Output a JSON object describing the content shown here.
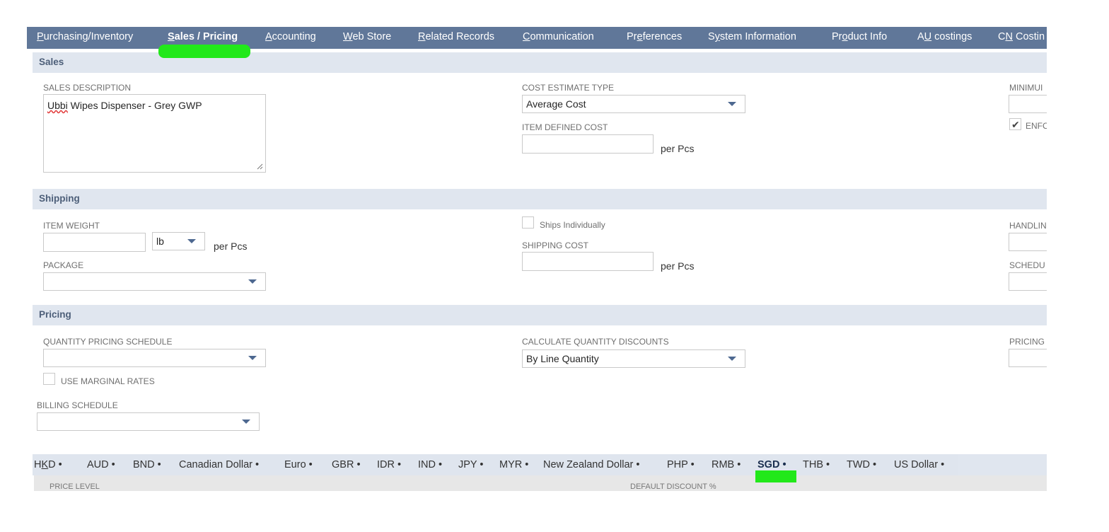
{
  "tabs": [
    {
      "pre": "",
      "ul": "P",
      "post": "urchasing/Inventory"
    },
    {
      "pre": "",
      "ul": "S",
      "post": "ales / Pricing"
    },
    {
      "pre": "",
      "ul": "A",
      "post": "ccounting"
    },
    {
      "pre": "",
      "ul": "W",
      "post": "eb Store"
    },
    {
      "pre": "",
      "ul": "R",
      "post": "elated Records"
    },
    {
      "pre": "",
      "ul": "C",
      "post": "ommunication"
    },
    {
      "pre": "Pr",
      "ul": "e",
      "post": "ferences"
    },
    {
      "pre": "S",
      "ul": "y",
      "post": "stem Information"
    },
    {
      "pre": "Pr",
      "ul": "o",
      "post": "duct Info"
    },
    {
      "pre": "A",
      "ul": "U",
      "post": " costings"
    },
    {
      "pre": "C",
      "ul": "N",
      "post": " Costin"
    }
  ],
  "sections": {
    "sales": "Sales",
    "shipping": "Shipping",
    "pricing": "Pricing"
  },
  "sales": {
    "sales_description_label": "Sales Description",
    "sales_description_word1": "Ubbi",
    "sales_description_rest": " Wipes Dispenser - Grey GWP",
    "cost_estimate_type_label": "Cost Estimate Type",
    "cost_estimate_type_value": "Average Cost",
    "item_defined_cost_label": "Item Defined Cost",
    "per_unit": "per Pcs",
    "minimum_label": "MINIMUI",
    "enforce_label": "ENFC"
  },
  "shipping": {
    "item_weight_label": "Item Weight",
    "weight_unit": "lb",
    "per_unit": "per Pcs",
    "package_label": "Package",
    "ships_individually_label": "Ships Individually",
    "shipping_cost_label": "Shipping Cost",
    "shipping_per_unit": "per Pcs",
    "handling_label": "HANDLIN",
    "schedule_label": "SCHEDU"
  },
  "pricing": {
    "quantity_pricing_schedule_label": "Quantity Pricing Schedule",
    "use_marginal_rates_label": "Use Marginal Rates",
    "billing_schedule_label": "Billing Schedule",
    "calculate_quantity_discounts_label": "Calculate Quantity Discounts",
    "calculate_quantity_discounts_value": "By Line Quantity",
    "pricing_label": "PRICING"
  },
  "currencies": [
    {
      "pre": "H",
      "ul": "K",
      "post": "D",
      "dot": " •"
    },
    {
      "pre": "",
      "ul": "",
      "post": "AUD",
      "dot": " •"
    },
    {
      "pre": "",
      "ul": "",
      "post": "BND",
      "dot": " •"
    },
    {
      "pre": "",
      "ul": "",
      "post": "Canadian Dollar",
      "dot": " •"
    },
    {
      "pre": "",
      "ul": "",
      "post": "Euro",
      "dot": " •"
    },
    {
      "pre": "",
      "ul": "",
      "post": "GBR",
      "dot": " •"
    },
    {
      "pre": "",
      "ul": "",
      "post": "IDR",
      "dot": " •"
    },
    {
      "pre": "",
      "ul": "",
      "post": "IND",
      "dot": " •"
    },
    {
      "pre": "",
      "ul": "",
      "post": "JPY",
      "dot": " •"
    },
    {
      "pre": "",
      "ul": "",
      "post": "MYR",
      "dot": " •"
    },
    {
      "pre": "",
      "ul": "",
      "post": "New Zealand Dollar",
      "dot": " •"
    },
    {
      "pre": "",
      "ul": "",
      "post": "PHP",
      "dot": " •"
    },
    {
      "pre": "",
      "ul": "",
      "post": "RMB",
      "dot": " •"
    },
    {
      "pre": "",
      "ul": "",
      "post": "SGD",
      "dot": " •"
    },
    {
      "pre": "",
      "ul": "",
      "post": "THB",
      "dot": " •"
    },
    {
      "pre": "",
      "ul": "",
      "post": "TWD",
      "dot": " •"
    },
    {
      "pre": "",
      "ul": "",
      "post": "US Dollar",
      "dot": " •"
    }
  ],
  "price_table": {
    "col_price_level": "Price Level",
    "col_default_discount": "Default Discount %"
  },
  "colors": {
    "tab_bar": "#607799",
    "section_header": "#e0e6ef",
    "highlight_marker": "#22e81a"
  }
}
